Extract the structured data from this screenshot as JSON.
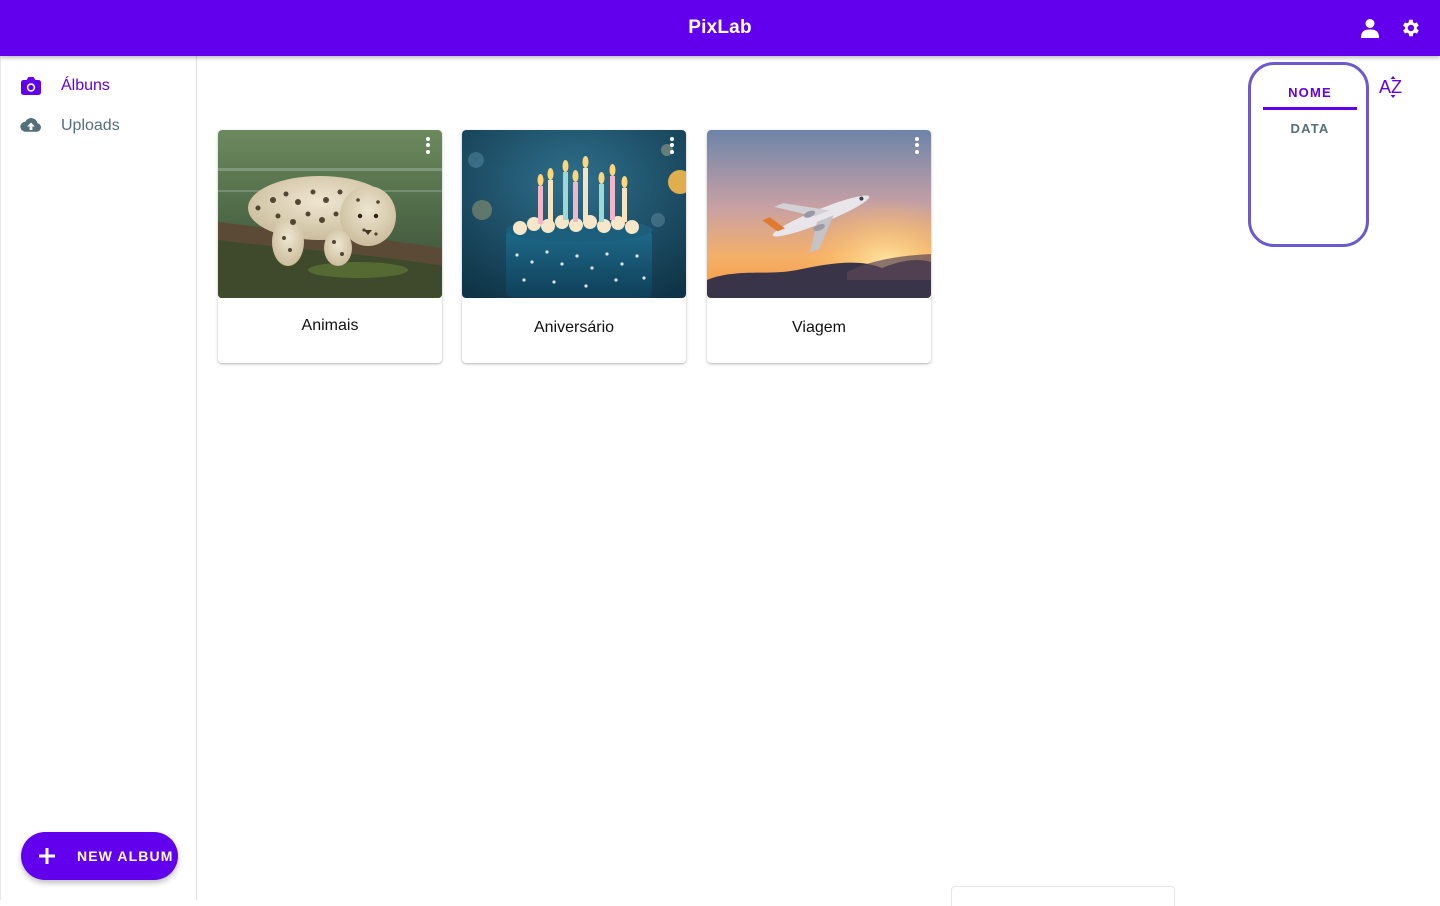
{
  "app": {
    "title": "PixLab"
  },
  "header": {
    "account_icon": "account-icon",
    "settings_icon": "gear-icon",
    "background_color": "#6200ee"
  },
  "sidebar": {
    "items": [
      {
        "label": "Álbuns",
        "icon": "camera-icon",
        "active": true
      },
      {
        "label": "Uploads",
        "icon": "cloud-upload-icon",
        "active": false
      }
    ],
    "new_album_button": {
      "label": "NEW ALBUM",
      "icon": "plus-icon"
    }
  },
  "albums": [
    {
      "title": "Animais",
      "thumbnail": "leopard resting on a log",
      "menu_icon": "more-vert-icon"
    },
    {
      "title": "Aniversário",
      "thumbnail": "birthday cake with candles",
      "menu_icon": "more-vert-icon"
    },
    {
      "title": "Viagem",
      "thumbnail": "airplane flying at sunset",
      "menu_icon": "more-vert-icon"
    }
  ],
  "sort": {
    "tabs": [
      {
        "label": "NOME",
        "active": true
      },
      {
        "label": "DATA",
        "active": false
      }
    ],
    "order_toggle_label": "AZ",
    "order_icon": "sort-alpha-icon"
  },
  "colors": {
    "primary": "#6200ee",
    "inactive_text": "#546e7a",
    "sort_panel_border": "#6a5acd"
  }
}
